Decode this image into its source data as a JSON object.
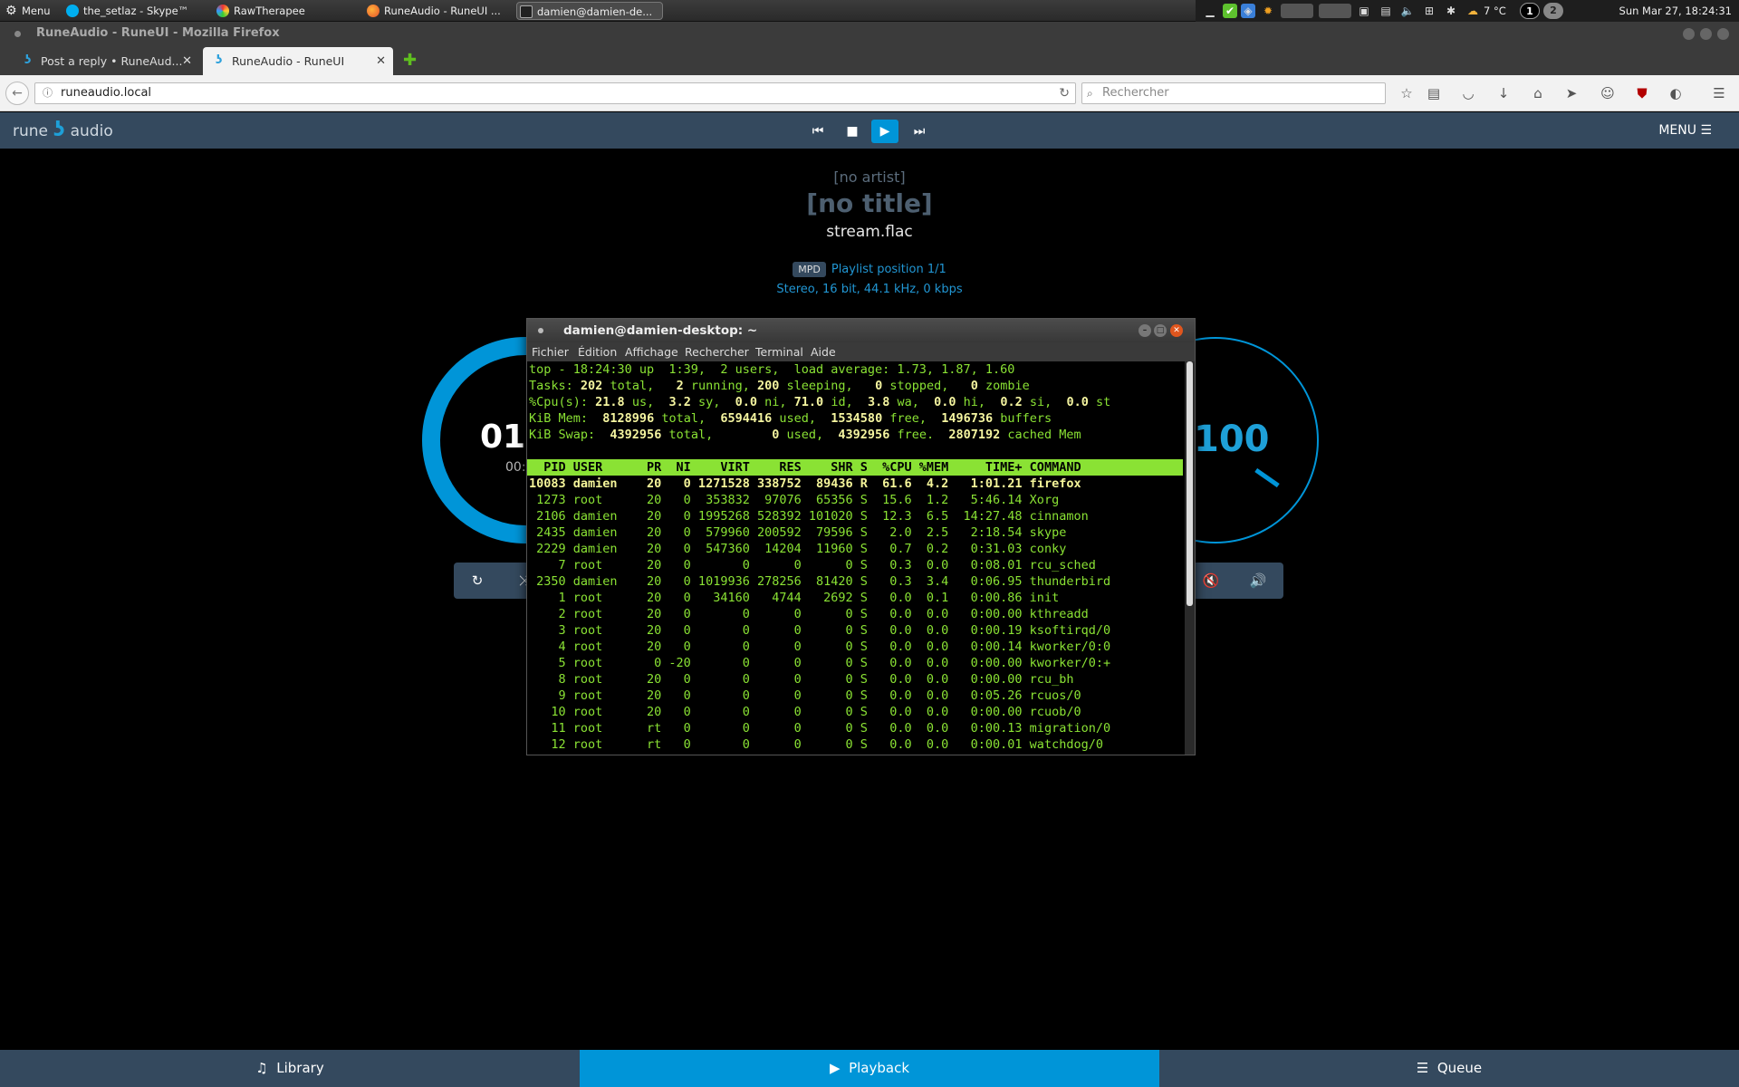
{
  "system_panel": {
    "menu_label": "Menu",
    "tasks": [
      {
        "label": "the_setlaz - Skype™"
      },
      {
        "label": "RawTherapee"
      },
      {
        "label": "RuneAudio - RuneUI ..."
      },
      {
        "label": "damien@damien-de..."
      }
    ],
    "temperature": "7 °C",
    "workspace_1": "1",
    "workspace_2": "2",
    "clock": "Sun Mar 27, 18:24:31"
  },
  "browser": {
    "window_title": "RuneAudio - RuneUI - Mozilla Firefox",
    "tabs": [
      {
        "label": "Post a reply • RuneAud..."
      },
      {
        "label": "RuneAudio - RuneUI"
      }
    ],
    "url": "runeaudio.local",
    "search_placeholder": "Rechercher"
  },
  "rune": {
    "logo_left": "rune",
    "logo_mark": "ʖ",
    "logo_right": "audio",
    "menu_label": "MENU",
    "artist": "[no artist]",
    "title": "[no title]",
    "album": "stream.flac",
    "source_badge": "MPD",
    "playlist_position": "Playlist position 1/1",
    "format": "Stereo, 16 bit, 44.1 kHz, 0 kbps",
    "elapsed": "01:16",
    "total": "00:",
    "volume": "100",
    "bottom_nav": {
      "library": "Library",
      "playback": "Playback",
      "queue": "Queue"
    }
  },
  "terminal": {
    "title": "damien@damien-desktop: ~",
    "menu": [
      "Fichier",
      "Édition",
      "Affichage",
      "Rechercher",
      "Terminal",
      "Aide"
    ],
    "top_summary": {
      "line1": "top - 18:24:30 up  1:39,  2 users,  load average: 1.73, 1.87, 1.60",
      "tasks_label": "Tasks:",
      "tasks_total": "202",
      "tasks_running": "2",
      "tasks_sleeping": "200",
      "tasks_stopped": "0",
      "tasks_zombie": "0",
      "cpu_label": "%Cpu(s):",
      "cpu_us": "21.8",
      "cpu_sy": "3.2",
      "cpu_ni": "0.0",
      "cpu_id": "71.0",
      "cpu_wa": "3.8",
      "cpu_hi": "0.0",
      "cpu_si": "0.2",
      "cpu_st": "0.0",
      "mem_label": "KiB Mem:",
      "mem_total": "8128996",
      "mem_used": "6594416",
      "mem_free": "1534580",
      "mem_buffers": "1496736",
      "swap_label": "KiB Swap:",
      "swap_total": "4392956",
      "swap_used": "0",
      "swap_free": "4392956",
      "swap_cached": "2807192"
    },
    "header": "  PID USER      PR  NI    VIRT    RES    SHR S  %CPU %MEM     TIME+ COMMAND",
    "processes": [
      "10083 damien    20   0 1271528 338752  89436 R  61.6  4.2   1:01.21 firefox",
      " 1273 root      20   0  353832  97076  65356 S  15.6  1.2   5:46.14 Xorg",
      " 2106 damien    20   0 1995268 528392 101020 S  12.3  6.5  14:27.48 cinnamon",
      " 2435 damien    20   0  579960 200592  79596 S   2.0  2.5   2:18.54 skype",
      " 2229 damien    20   0  547360  14204  11960 S   0.7  0.2   0:31.03 conky",
      "    7 root      20   0       0      0      0 S   0.3  0.0   0:08.01 rcu_sched",
      " 2350 damien    20   0 1019936 278256  81420 S   0.3  3.4   0:06.95 thunderbird",
      "    1 root      20   0   34160   4744   2692 S   0.0  0.1   0:00.86 init",
      "    2 root      20   0       0      0      0 S   0.0  0.0   0:00.00 kthreadd",
      "    3 root      20   0       0      0      0 S   0.0  0.0   0:00.19 ksoftirqd/0",
      "    4 root      20   0       0      0      0 S   0.0  0.0   0:00.14 kworker/0:0",
      "    5 root       0 -20       0      0      0 S   0.0  0.0   0:00.00 kworker/0:+",
      "    8 root      20   0       0      0      0 S   0.0  0.0   0:00.00 rcu_bh",
      "    9 root      20   0       0      0      0 S   0.0  0.0   0:05.26 rcuos/0",
      "   10 root      20   0       0      0      0 S   0.0  0.0   0:00.00 rcuob/0",
      "   11 root      rt   0       0      0      0 S   0.0  0.0   0:00.13 migration/0",
      "   12 root      rt   0       0      0      0 S   0.0  0.0   0:00.01 watchdog/0"
    ]
  }
}
